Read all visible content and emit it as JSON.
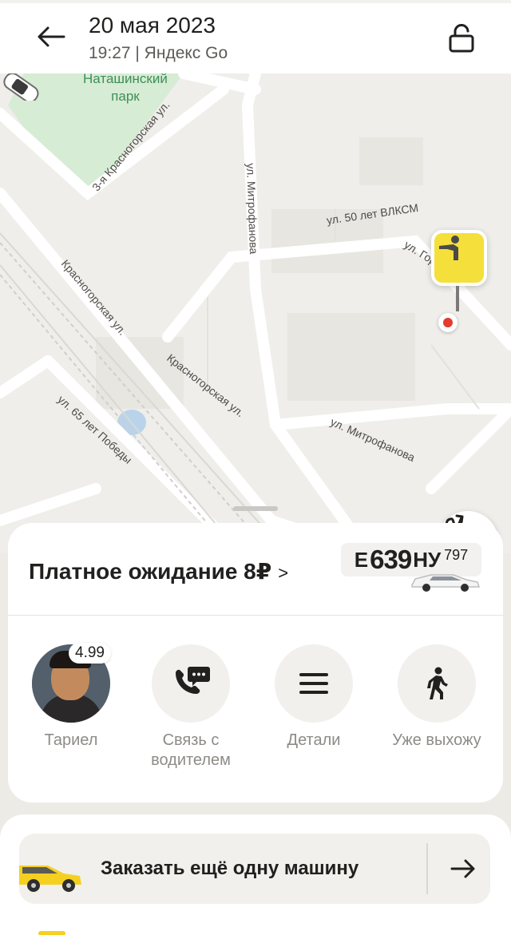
{
  "header": {
    "date": "20 мая 2023",
    "subtitle": "19:27 | Яндекс Go",
    "back_icon": "arrow-left-icon",
    "lock_icon": "lock-open-icon"
  },
  "map": {
    "park_label": "Наташинский\nпарк",
    "streets": [
      "3-я Красногорская ул.",
      "ул. Митрофанова",
      "ул. 50 лет ВЛКСМ",
      "ул. Горатимов",
      "Красногорская ул.",
      "Красногорская ул.",
      "ул. Митрофанова",
      "ул. 65 лет Победы"
    ],
    "pin_icon": "person-waving-icon",
    "route_icon": "route-icon"
  },
  "trip": {
    "paid_wait": "Платное ожидание 8₽",
    "chevron": ">",
    "plate": {
      "letter1": "Е",
      "number": "639",
      "letters2": "НУ",
      "region": "797"
    }
  },
  "actions": {
    "driver": {
      "name": "Тариел",
      "rating": "4.99"
    },
    "contact": {
      "label": "Связь с водителем",
      "icon": "phone-chat-icon"
    },
    "details": {
      "label": "Детали",
      "icon": "menu-icon"
    },
    "coming_out": {
      "label": "Уже выхожу",
      "icon": "walking-person-icon"
    }
  },
  "order_more": {
    "label": "Заказать ещё одну машину",
    "arrow_icon": "arrow-right-icon"
  },
  "colors": {
    "accent_yellow": "#f5df3a",
    "pin_red": "#e33b2e",
    "park_green": "#3f8e5a"
  }
}
